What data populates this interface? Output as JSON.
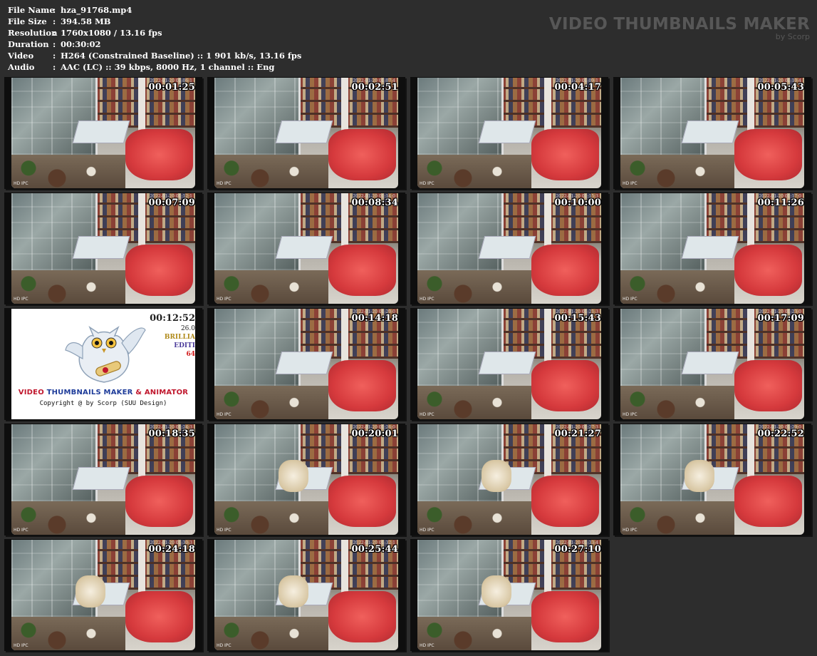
{
  "info": [
    {
      "label": "File Name",
      "value": "hza_91768.mp4"
    },
    {
      "label": "File Size",
      "value": "394.58 MB"
    },
    {
      "label": "Resolution",
      "value": "1760x1080 / 13.16 fps"
    },
    {
      "label": "Duration",
      "value": "00:30:02"
    },
    {
      "label": "Video",
      "value": "H264 (Constrained Baseline) :: 1 901 kb/s, 13.16 fps"
    },
    {
      "label": "Audio",
      "value": "AAC (LC) :: 39 kbps, 8000 Hz, 1 channel :: Eng"
    }
  ],
  "separator": ":",
  "brand": {
    "title": "VIDEO THUMBNAILS MAKER",
    "subtitle": "by Scorp"
  },
  "osd": {
    "label": "HD IPC"
  },
  "thumbnails": [
    {
      "time": "00:01:25",
      "osd_time": "2022-01-20 01:06:1"
    },
    {
      "time": "00:02:51",
      "osd_time": "2022-01-20 01:07:4"
    },
    {
      "time": "00:04:17",
      "osd_time": "2022-01-20 01:09:1"
    },
    {
      "time": "00:05:43",
      "osd_time": "2022-01-20 01:10:4"
    },
    {
      "time": "00:07:09",
      "osd_time": "2022-01-20 01:12:1"
    },
    {
      "time": "00:08:34",
      "osd_time": "2022-01-20 01:14:0"
    },
    {
      "time": "00:10:00",
      "osd_time": "2022-01-20 01:15:3"
    },
    {
      "time": "00:11:26",
      "osd_time": "2022-01-20 01:17:0"
    },
    {
      "time": "00:12:52",
      "logo": true
    },
    {
      "time": "00:14:18",
      "osd_time": "2022-01-20 01:20:0"
    },
    {
      "time": "00:15:43",
      "osd_time": "2022-01-20 01:21:3"
    },
    {
      "time": "00:17:09",
      "osd_time": "2022-01-20 01:23:0"
    },
    {
      "time": "00:18:35",
      "osd_time": "2022-01-20 01:24:3"
    },
    {
      "time": "00:20:01",
      "osd_time": "2022-01-20 01:26:0"
    },
    {
      "time": "00:21:27",
      "osd_time": "2022-01-20 01:27:3"
    },
    {
      "time": "00:22:52",
      "osd_time": "2022-01-20 01:29:0"
    },
    {
      "time": "00:24:18",
      "osd_time": "2022-01-20 01:30:3"
    },
    {
      "time": "00:25:44",
      "osd_time": "2022-01-20 01:32:1"
    },
    {
      "time": "00:27:10",
      "osd_time": "2022-01-20 01:33:4"
    }
  ],
  "logo": {
    "title_1": "VIDEO",
    "title_2": "THUMBNAILS MAKER",
    "title_3": "& ANIMATOR",
    "copyright": "Copyright @ by Scorp (SUU Design)",
    "version": "26.0",
    "side_1": "BRILLIA",
    "side_2": "EDITI",
    "side_3": "64"
  },
  "colors": {
    "background": "#2d2d2d",
    "brand_text": "#575757",
    "logo_red": "#c0172d",
    "logo_blue": "#1e3c9a"
  }
}
